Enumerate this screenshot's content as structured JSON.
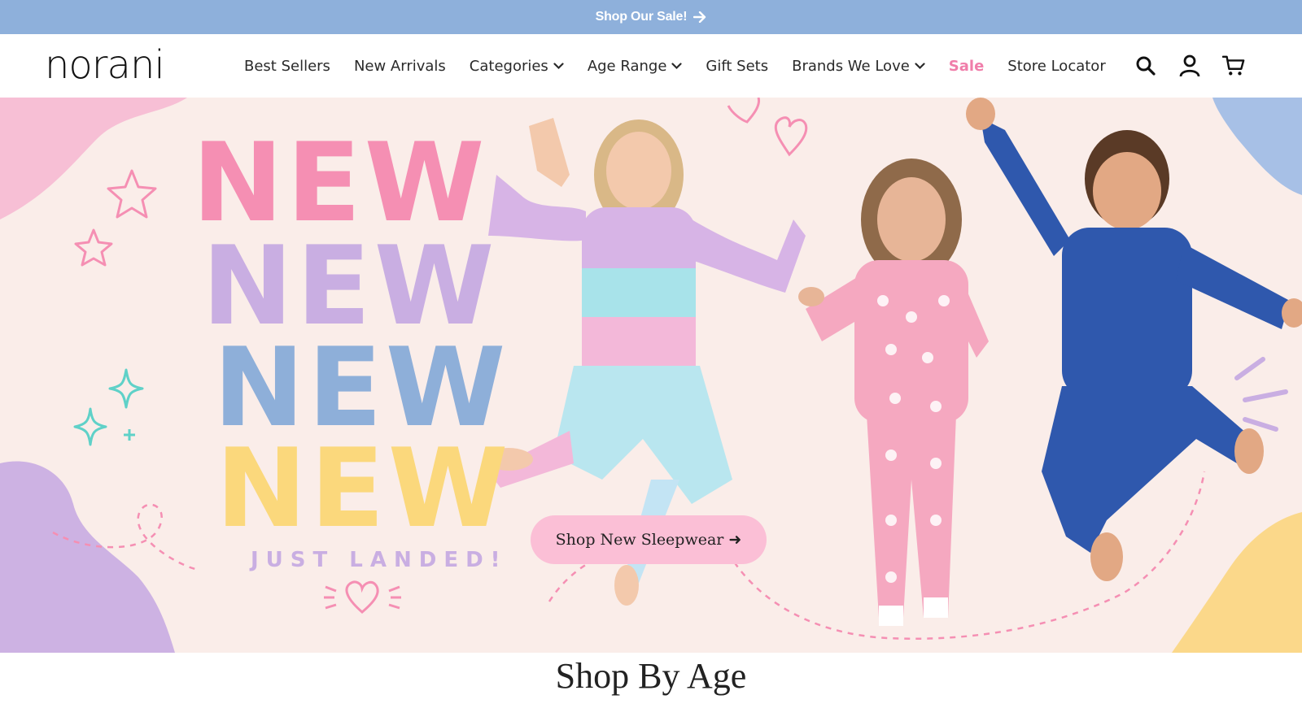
{
  "announcement": {
    "text": "Shop Our Sale!",
    "icon": "arrow-right-icon"
  },
  "brand": {
    "logo_text": "norani"
  },
  "nav": {
    "items": [
      {
        "label": "Best Sellers",
        "dropdown": false
      },
      {
        "label": "New Arrivals",
        "dropdown": false
      },
      {
        "label": "Categories",
        "dropdown": true
      },
      {
        "label": "Age Range",
        "dropdown": true
      },
      {
        "label": "Gift Sets",
        "dropdown": false
      },
      {
        "label": "Brands We Love",
        "dropdown": true
      },
      {
        "label": "Sale",
        "dropdown": false,
        "highlight": true
      },
      {
        "label": "Store Locator",
        "dropdown": false
      }
    ]
  },
  "header_icons": [
    "search-icon",
    "account-icon",
    "cart-icon"
  ],
  "hero": {
    "headline_lines": [
      "NEW",
      "NEW",
      "NEW",
      "NEW"
    ],
    "subline": "JUST LANDED!",
    "cta_label": "Shop New Sleepwear ➜"
  },
  "sections": {
    "shop_by_age_title": "Shop By Age"
  },
  "colors": {
    "announce_bg": "#8eb0db",
    "sale": "#f07eaa",
    "pink": "#f58fb3",
    "lavender": "#c9aee2",
    "blue": "#8eafd9",
    "yellow": "#fbd87c",
    "cta_bg": "#fbbfd6",
    "hero_bg": "#faede9"
  }
}
